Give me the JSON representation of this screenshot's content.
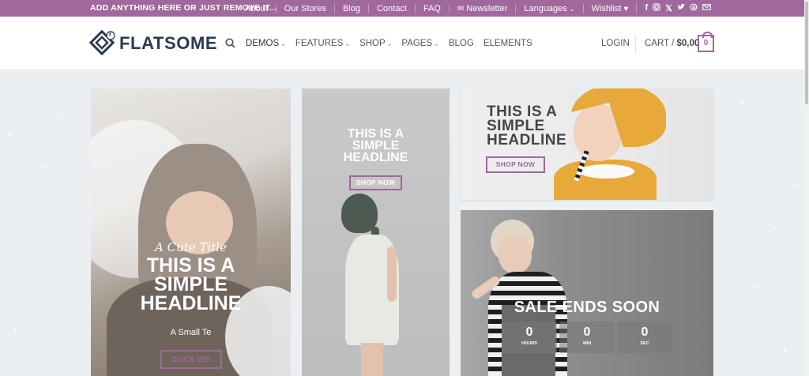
{
  "topbar": {
    "announcement": "ADD ANYTHING HERE OR JUST REMOVE IT...",
    "links": [
      "About",
      "Our Stores",
      "Blog",
      "Contact",
      "FAQ",
      "Newsletter",
      "Languages",
      "Wishlist"
    ],
    "social_icons": [
      "facebook-icon",
      "instagram-icon",
      "x-icon",
      "twitter-icon",
      "threads-icon",
      "email-icon"
    ]
  },
  "header": {
    "logo_text": "FLATSOME",
    "logo_badge": "3",
    "nav": [
      {
        "label": "DEMOS",
        "dropdown": true
      },
      {
        "label": "FEATURES",
        "dropdown": true
      },
      {
        "label": "SHOP",
        "dropdown": true
      },
      {
        "label": "PAGES",
        "dropdown": true
      },
      {
        "label": "BLOG",
        "dropdown": false
      },
      {
        "label": "ELEMENTS",
        "dropdown": false
      }
    ],
    "login": "LOGIN",
    "cart_label": "CART /",
    "cart_total": "$0,00",
    "cart_count": "0"
  },
  "banner1": {
    "script_title": "A Cute Title",
    "headline": [
      "THIS IS A",
      "SIMPLE",
      "HEADLINE"
    ],
    "small_text": "A Small Te",
    "button": "CLICK ME!"
  },
  "banner2": {
    "headline": [
      "THIS IS A",
      "SIMPLE",
      "HEADLINE"
    ],
    "button": "SHOP NOW"
  },
  "banner3": {
    "headline": [
      "THIS IS A",
      "SIMPLE",
      "HEADLINE"
    ],
    "button": "SHOP NOW"
  },
  "banner4": {
    "headline": "SALE ENDS SOON",
    "countdown": [
      {
        "value": "0",
        "unit": "HOURS"
      },
      {
        "value": "0",
        "unit": "MIN"
      },
      {
        "value": "0",
        "unit": "SEC"
      }
    ]
  },
  "colors": {
    "brand": "#a0689c",
    "logo": "#2b3a4e"
  }
}
